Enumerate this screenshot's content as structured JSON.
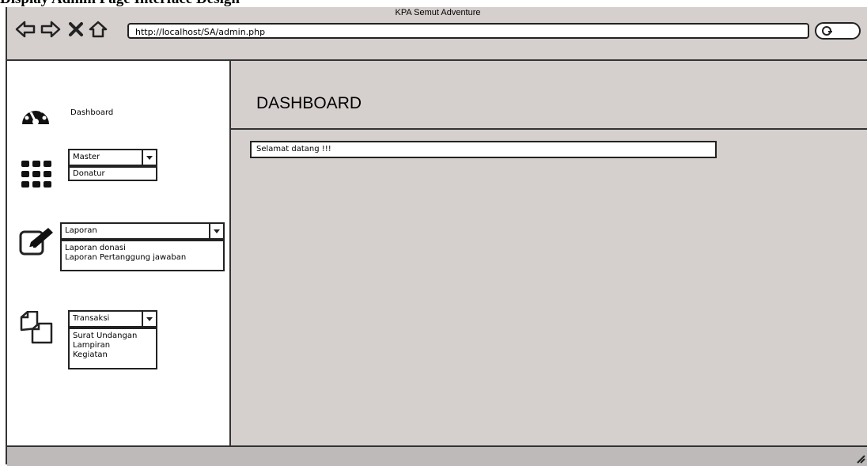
{
  "caption": "Display Admin Page Interface Design",
  "window": {
    "title": "KPA Semut Adventure",
    "url": "http://localhost/SA/admin.php"
  },
  "sidebar": {
    "dashboard_label": "Dashboard",
    "master": {
      "selected": "Master",
      "options": [
        "Donatur"
      ]
    },
    "laporan": {
      "selected": "Laporan",
      "options": [
        "Laporan donasi",
        "Laporan Pertanggung jawaban"
      ]
    },
    "transaksi": {
      "selected": "Transaksi",
      "options": [
        "Surat Undangan",
        "Lampiran",
        "Kegiatan"
      ]
    }
  },
  "main": {
    "title": "DASHBOARD",
    "welcome": "Selamat datang !!!"
  },
  "icons": {
    "back": "back-arrow-icon",
    "forward": "forward-arrow-icon",
    "stop": "close-icon",
    "home": "home-icon",
    "search": "search-icon",
    "dashboard": "dashboard-gauge-icon",
    "master": "grid-icon",
    "laporan": "edit-icon",
    "transaksi": "copy-icon"
  }
}
